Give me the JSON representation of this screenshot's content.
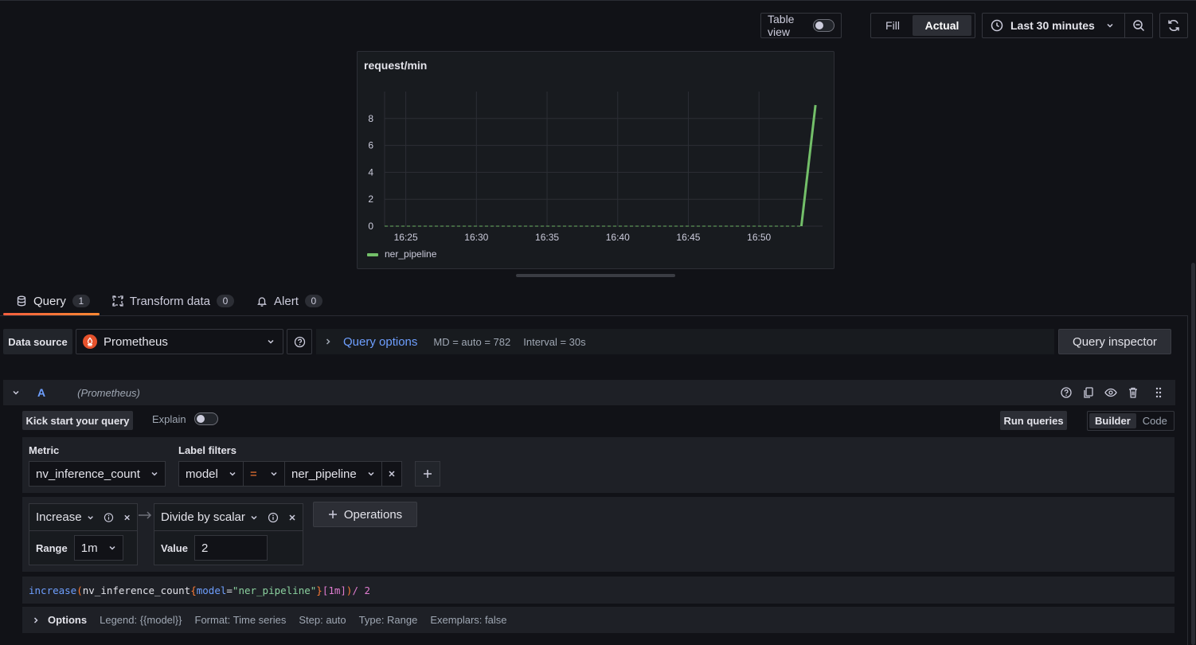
{
  "toolbar": {
    "table_view_label": "Table view",
    "fill_label": "Fill",
    "actual_label": "Actual",
    "time_range": "Last 30 minutes"
  },
  "panel": {
    "title": "request/min",
    "legend": "ner_pipeline",
    "series_color": "#73bf69"
  },
  "chart_data": {
    "type": "line",
    "title": "request/min",
    "x_ticks": [
      "16:25",
      "16:30",
      "16:35",
      "16:40",
      "16:45",
      "16:50"
    ],
    "y_ticks": [
      0,
      2,
      4,
      6,
      8
    ],
    "ylim": [
      0,
      10
    ],
    "series": [
      {
        "name": "ner_pipeline",
        "x": [
          "16:23",
          "16:53",
          "16:54"
        ],
        "y": [
          0,
          0,
          9
        ]
      }
    ],
    "grid": true,
    "legend_position": "bottom-left"
  },
  "tabs": [
    {
      "label": "Query",
      "count": "1"
    },
    {
      "label": "Transform data",
      "count": "0"
    },
    {
      "label": "Alert",
      "count": "0"
    }
  ],
  "datasource": {
    "label": "Data source",
    "selected": "Prometheus",
    "query_options_label": "Query options",
    "md": "MD = auto = 782",
    "interval": "Interval = 30s",
    "inspector_label": "Query inspector"
  },
  "query": {
    "ref_id": "A",
    "datasource_hint": "(Prometheus)",
    "kick_start_label": "Kick start your query",
    "explain_label": "Explain",
    "run_label": "Run queries",
    "builder_label": "Builder",
    "code_label": "Code",
    "metric_label": "Metric",
    "metric_value": "nv_inference_count",
    "label_filters_label": "Label filters",
    "filter_key": "model",
    "filter_op": "=",
    "filter_value": "ner_pipeline",
    "op1_name": "Increase",
    "op1_param_label": "Range",
    "op1_param_value": "1m",
    "op2_name": "Divide by scalar",
    "op2_param_label": "Value",
    "op2_param_value": "2",
    "operations_label": "Operations",
    "preview": {
      "fn": "increase",
      "open": "(",
      "metric": "nv_inference_count",
      "brace_open": "{",
      "label": "model",
      "eq": "=",
      "value": "\"ner_pipeline\"",
      "brace_close": "}",
      "range": "[1m]",
      "close": ")",
      "rest": " / 2"
    }
  },
  "options": {
    "label": "Options",
    "legend": "Legend: {{model}}",
    "format": "Format: Time series",
    "step": "Step: auto",
    "type": "Type: Range",
    "exemplars": "Exemplars: false"
  }
}
